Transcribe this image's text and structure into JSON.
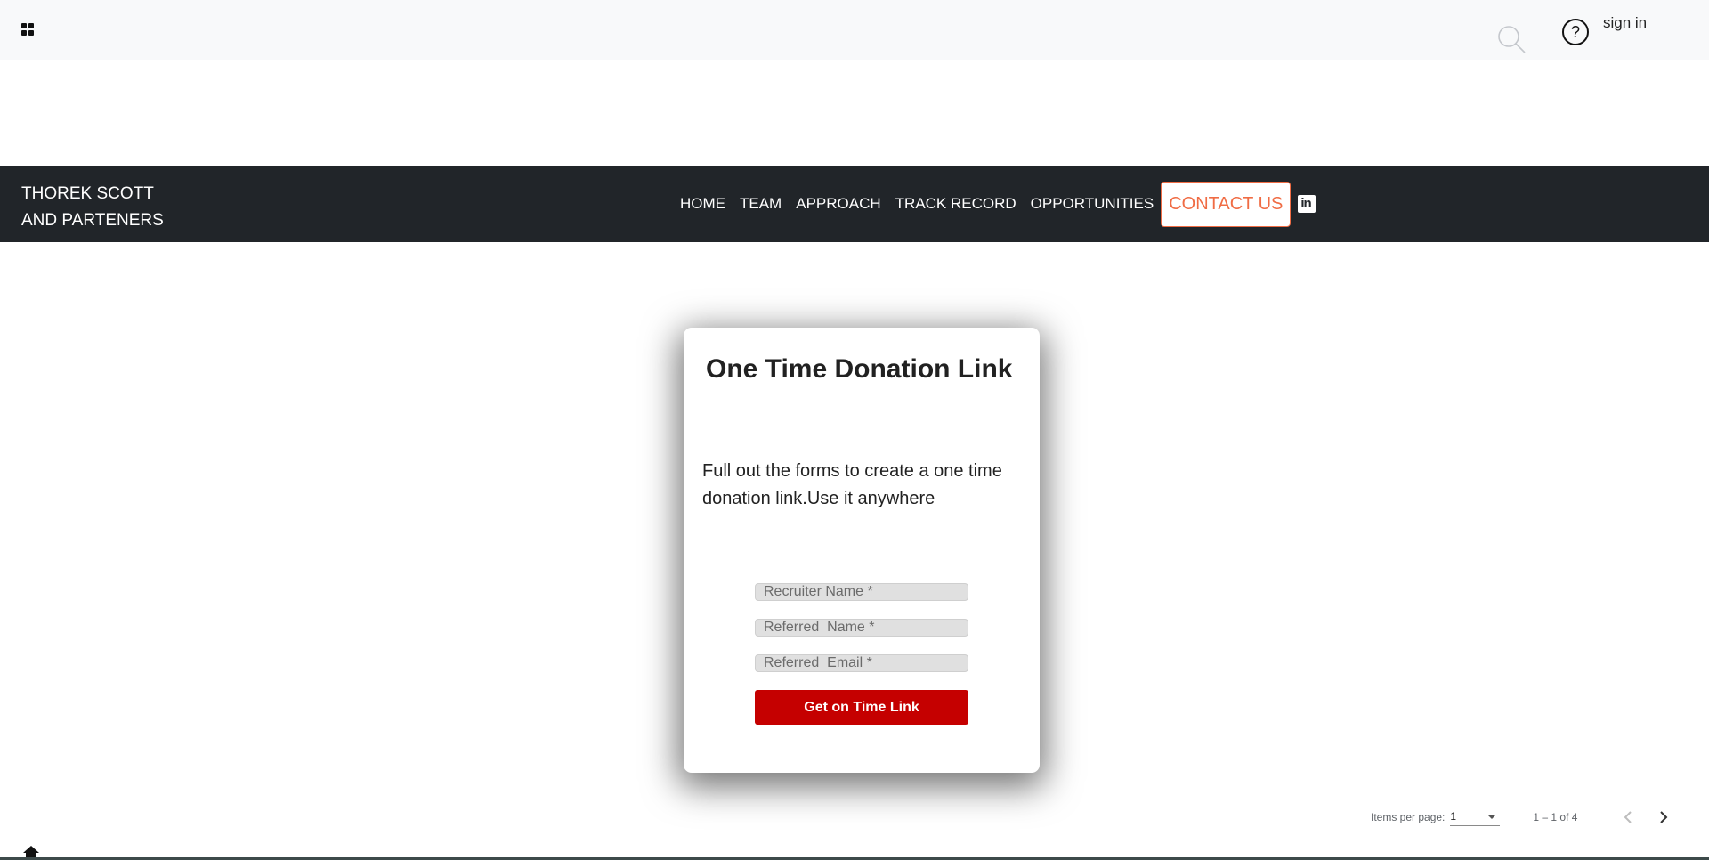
{
  "header": {
    "signin_label": "sign in"
  },
  "icons": {
    "apps": "apps-grid-icon",
    "search": "search-icon",
    "help": "help-circle-icon",
    "linkedin": "linkedin-icon",
    "home": "home-icon",
    "prev": "chevron-left-icon",
    "next": "chevron-right-icon"
  },
  "navbar": {
    "brand_line1": "THOREK SCOTT",
    "brand_line2": "AND PARTENERS",
    "items": [
      {
        "label": "HOME"
      },
      {
        "label": "TEAM"
      },
      {
        "label": "APPROACH"
      },
      {
        "label": "TRACK RECORD"
      },
      {
        "label": "OPPORTUNITIES"
      }
    ],
    "contact_label": "CONTACT US",
    "linkedin_glyph": "in"
  },
  "card": {
    "title": "One Time Donation Link",
    "description": "Full out the forms to create a one time donation link.Use it anywhere",
    "fields": {
      "recruiter_name_placeholder": "Recruiter Name *",
      "referred_name_placeholder": "Referred  Name *",
      "referred_email_placeholder": "Referred  Email *"
    },
    "submit_label": "Get on Time Link"
  },
  "paginator": {
    "items_per_page_label": "Items per page:",
    "items_per_page_value": "1",
    "range_label": "1 – 1 of 4"
  },
  "colors": {
    "navbar_bg": "#212529",
    "topbar_bg": "#f8f9fa",
    "contact_accent": "#f06c44",
    "submit_bg": "#c50000"
  }
}
